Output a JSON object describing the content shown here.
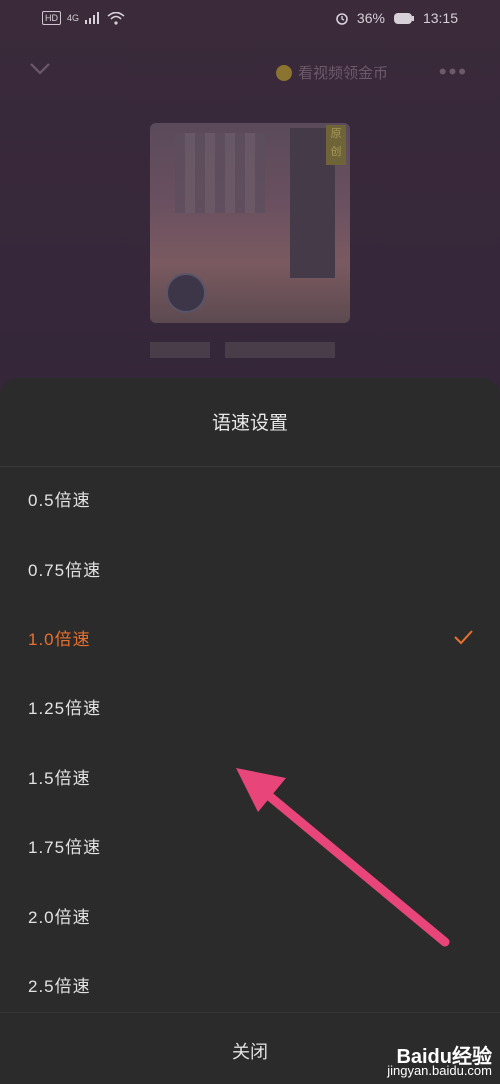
{
  "status": {
    "network": "4G",
    "battery": "36%",
    "time": "13:15"
  },
  "topbar": {
    "coin_text": "看视频领金币"
  },
  "cover": {
    "badge": "原创"
  },
  "sheet": {
    "title": "语速设置",
    "options": [
      "0.5倍速",
      "0.75倍速",
      "1.0倍速",
      "1.25倍速",
      "1.5倍速",
      "1.75倍速",
      "2.0倍速",
      "2.5倍速"
    ],
    "selected": "1.0倍速",
    "close_label": "关闭"
  },
  "watermark": {
    "brand": "Baidu经验",
    "url": "jingyan.baidu.com"
  },
  "colors": {
    "accent": "#e8702e",
    "arrow": "#e8457a"
  }
}
